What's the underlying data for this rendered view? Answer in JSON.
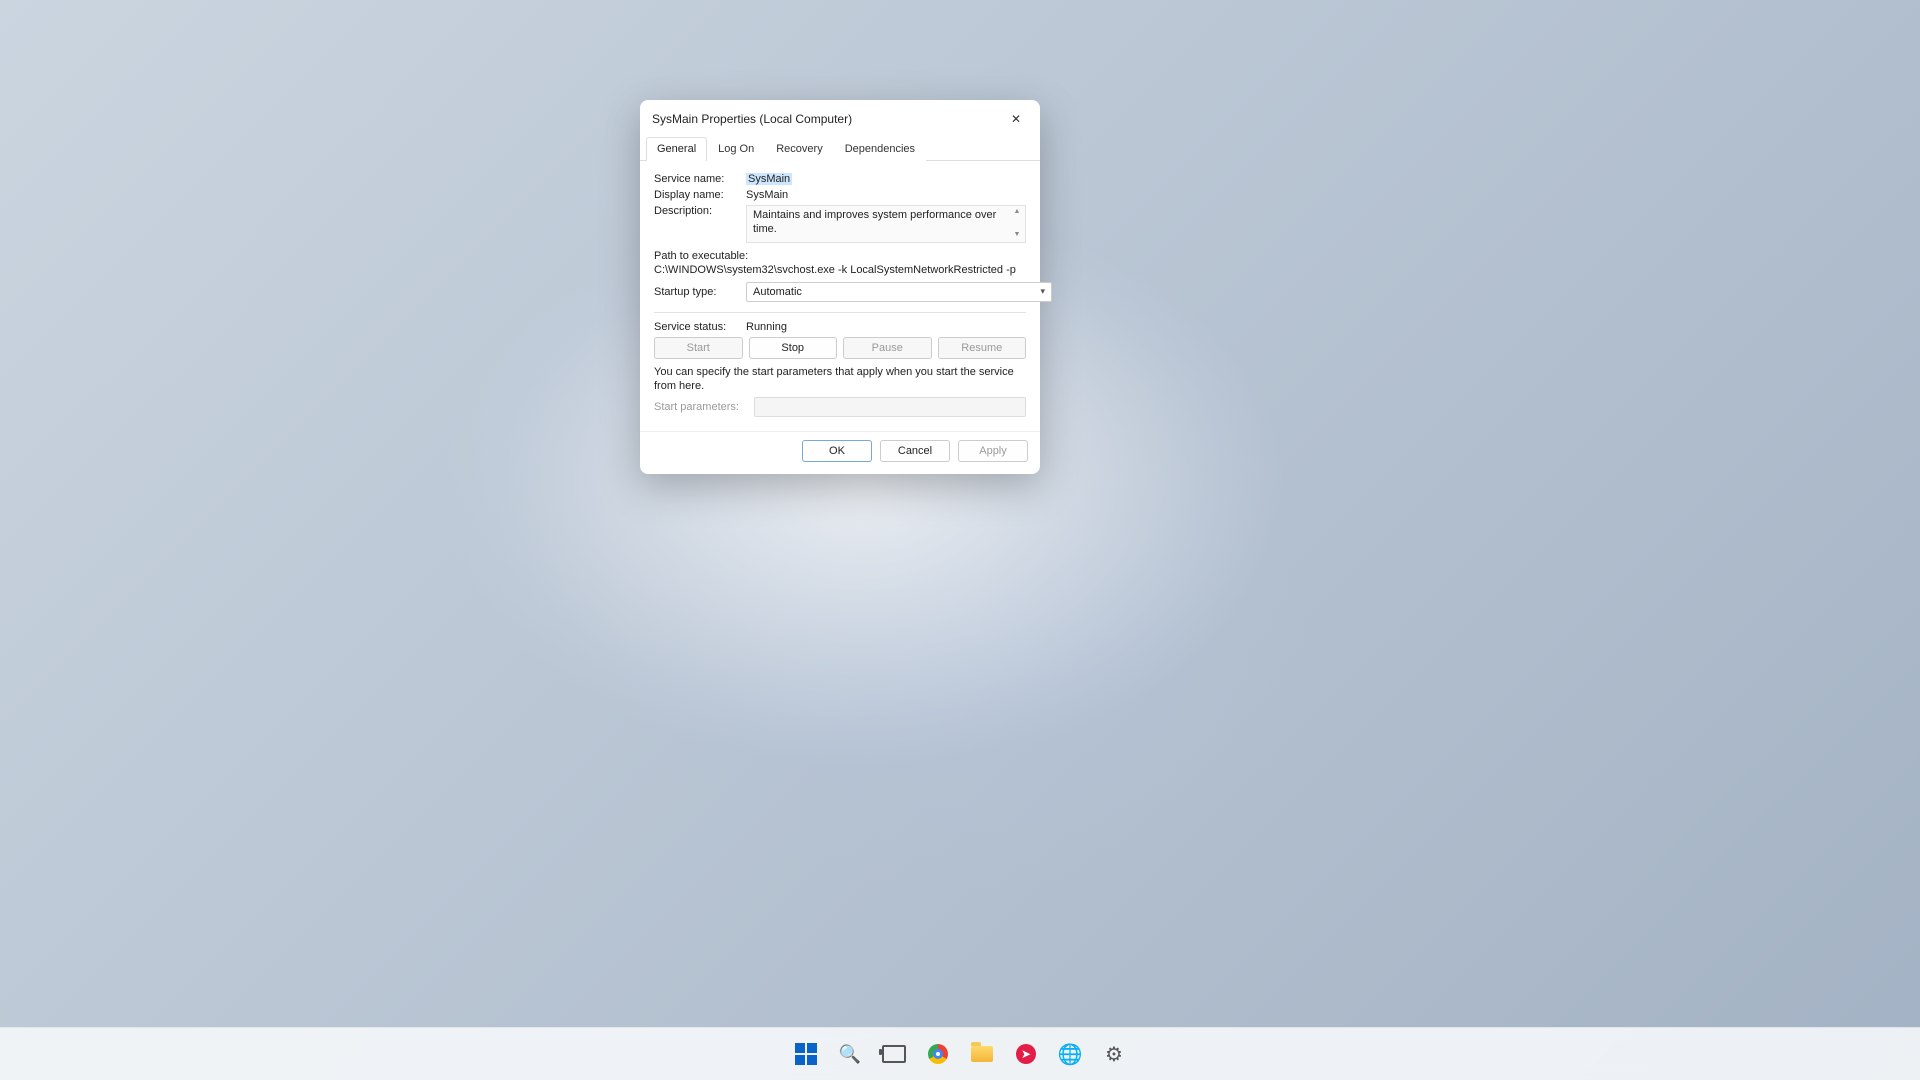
{
  "dialog": {
    "title": "SysMain Properties (Local Computer)",
    "tabs": [
      "General",
      "Log On",
      "Recovery",
      "Dependencies"
    ],
    "active_tab": "General",
    "labels": {
      "service_name": "Service name:",
      "display_name": "Display name:",
      "description": "Description:",
      "path": "Path to executable:",
      "startup_type": "Startup type:",
      "service_status": "Service status:",
      "start_params": "Start parameters:"
    },
    "values": {
      "service_name": "SysMain",
      "display_name": "SysMain",
      "description": "Maintains and improves system performance over time.",
      "path": "C:\\WINDOWS\\system32\\svchost.exe -k LocalSystemNetworkRestricted -p",
      "startup_type": "Automatic",
      "service_status": "Running",
      "start_params": ""
    },
    "buttons": {
      "start": "Start",
      "stop": "Stop",
      "pause": "Pause",
      "resume": "Resume"
    },
    "hint": "You can specify the start parameters that apply when you start the service from here.",
    "footer": {
      "ok": "OK",
      "cancel": "Cancel",
      "apply": "Apply"
    }
  },
  "taskbar": {
    "items": [
      "start",
      "search",
      "task-view",
      "chrome",
      "file-explorer",
      "app",
      "network",
      "settings"
    ]
  }
}
